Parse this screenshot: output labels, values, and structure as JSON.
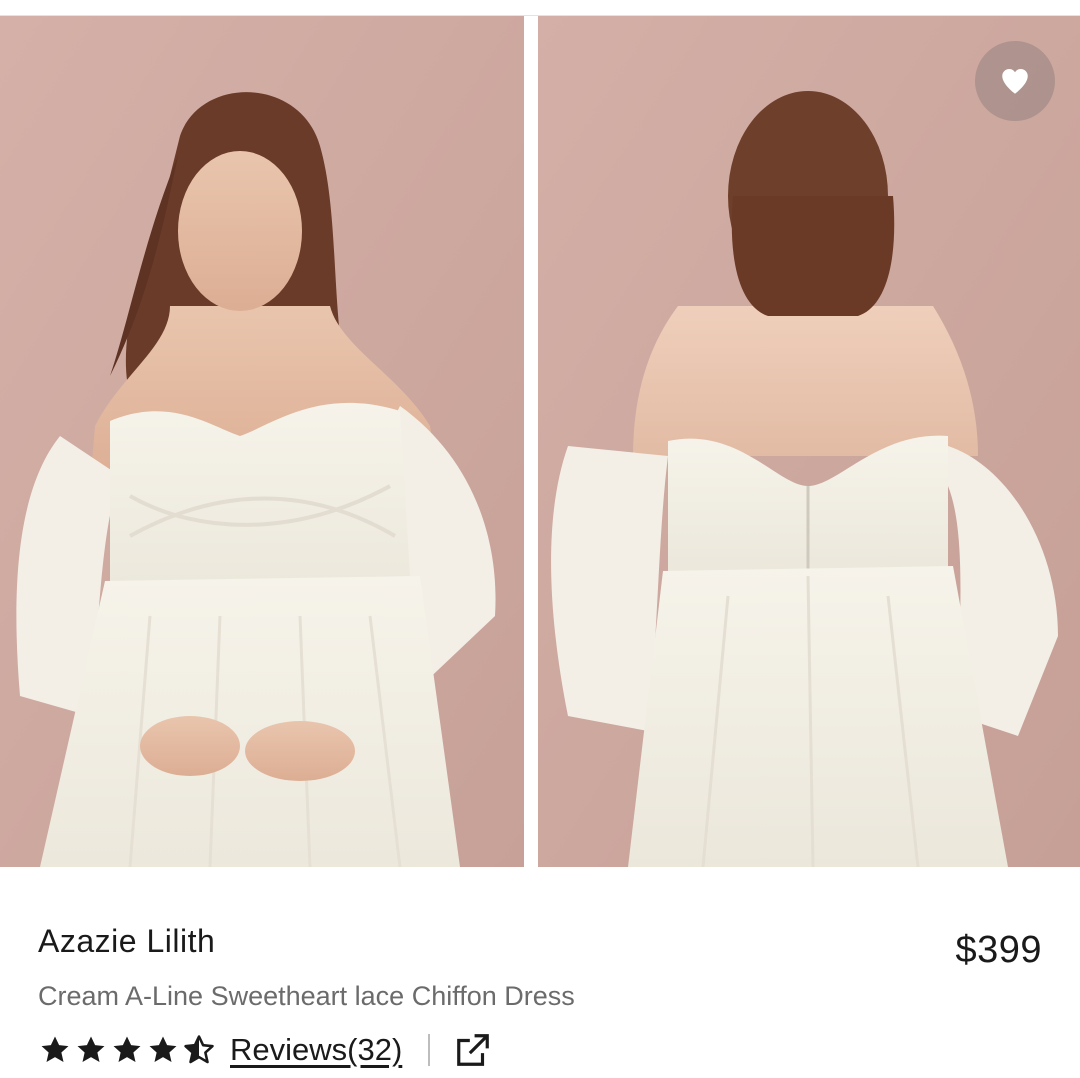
{
  "product": {
    "brand": "Azazie Lilith",
    "name": "Cream A-Line Sweetheart lace Chiffon Dress",
    "price": "$399"
  },
  "gallery": {
    "images": [
      {
        "view": "front"
      },
      {
        "view": "back"
      }
    ]
  },
  "rating": {
    "stars": 4.5,
    "max_stars": 5,
    "reviews_label": "Reviews(32)"
  },
  "icons": {
    "favorite": "heart-icon",
    "share": "external-link-icon",
    "rating": "star-icon"
  },
  "colors": {
    "backdrop": "#cfaaa2",
    "dress": "#f4f1e8",
    "text_primary": "#1a1a1a",
    "text_secondary": "#6b6b6b"
  }
}
